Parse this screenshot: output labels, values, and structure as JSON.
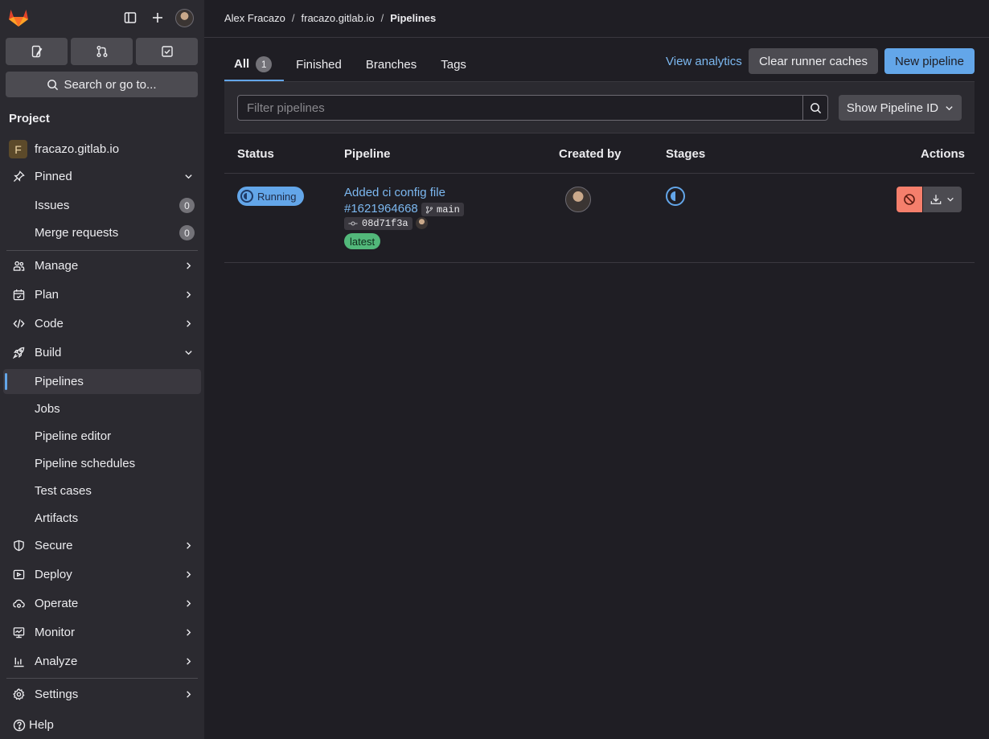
{
  "sidebar": {
    "search_label": "Search or go to...",
    "section_title": "Project",
    "project": {
      "initial": "F",
      "name": "fracazo.gitlab.io"
    },
    "pinned": {
      "label": "Pinned",
      "items": [
        {
          "label": "Issues",
          "count": "0"
        },
        {
          "label": "Merge requests",
          "count": "0"
        }
      ]
    },
    "groups": {
      "manage": "Manage",
      "plan": "Plan",
      "code": "Code",
      "build": "Build",
      "secure": "Secure",
      "deploy": "Deploy",
      "operate": "Operate",
      "monitor": "Monitor",
      "analyze": "Analyze",
      "settings": "Settings"
    },
    "build_items": {
      "pipelines": "Pipelines",
      "jobs": "Jobs",
      "pipeline_editor": "Pipeline editor",
      "pipeline_schedules": "Pipeline schedules",
      "test_cases": "Test cases",
      "artifacts": "Artifacts"
    },
    "help_label": "Help"
  },
  "breadcrumb": {
    "user": "Alex Fracazo",
    "project": "fracazo.gitlab.io",
    "current": "Pipelines",
    "sep": "/"
  },
  "tabs": {
    "all": "All",
    "all_count": "1",
    "finished": "Finished",
    "branches": "Branches",
    "tags": "Tags"
  },
  "actions": {
    "view_analytics": "View analytics",
    "clear_caches": "Clear runner caches",
    "new_pipeline": "New pipeline"
  },
  "filter": {
    "placeholder": "Filter pipelines",
    "show_id": "Show Pipeline ID"
  },
  "table": {
    "headers": {
      "status": "Status",
      "pipeline": "Pipeline",
      "created_by": "Created by",
      "stages": "Stages",
      "actions": "Actions"
    },
    "row": {
      "status": "Running",
      "title": "Added ci config file",
      "id": "#1621964668",
      "branch": "main",
      "sha": "08d71f3a",
      "badge": "latest"
    }
  },
  "colors": {
    "accent": "#63a6e9",
    "success": "#52b87a",
    "danger": "#f57f6c"
  }
}
